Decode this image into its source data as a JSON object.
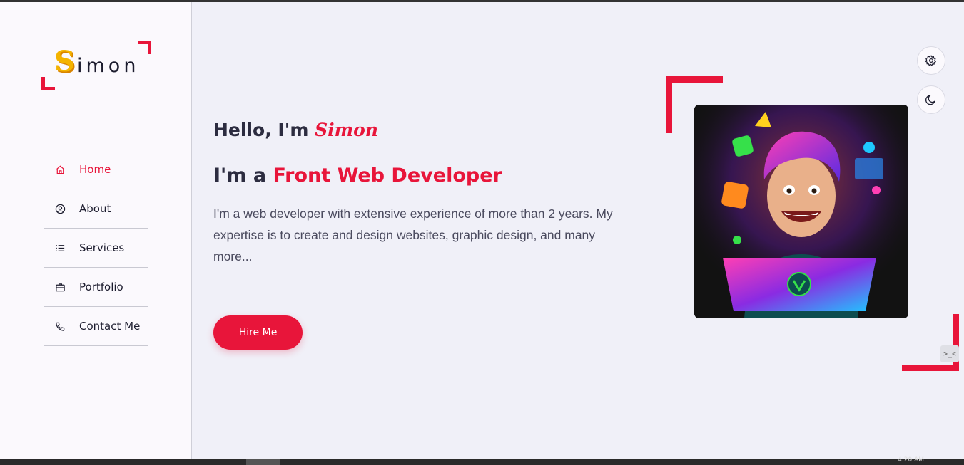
{
  "logo": {
    "mark": "S",
    "text": "imon"
  },
  "nav": {
    "items": [
      {
        "label": "Home",
        "icon": "home-icon",
        "active": true
      },
      {
        "label": "About",
        "icon": "user-circle-icon",
        "active": false
      },
      {
        "label": "Services",
        "icon": "list-icon",
        "active": false
      },
      {
        "label": "Portfolio",
        "icon": "briefcase-icon",
        "active": false
      },
      {
        "label": "Contact Me",
        "icon": "phone-icon",
        "active": false
      }
    ]
  },
  "hero": {
    "greeting_prefix": "Hello, I'm ",
    "greeting_name": "Simon",
    "role_prefix": "I'm a ",
    "role": "Front Web Developer",
    "description": "I'm a web developer with extensive experience of more than 2 years. My expertise is to create and design websites, graphic design, and many more...",
    "cta_label": "Hire Me"
  },
  "controls": {
    "settings_icon": "gear-icon",
    "theme_icon": "moon-icon",
    "side_toggle": ">_<"
  },
  "taskbar": {
    "clock": "4:20 AM"
  },
  "colors": {
    "accent": "#e8153a",
    "sidebar_bg": "#fbf9fd",
    "main_bg": "#f0f0f8",
    "text_dark": "#2c2c40"
  }
}
